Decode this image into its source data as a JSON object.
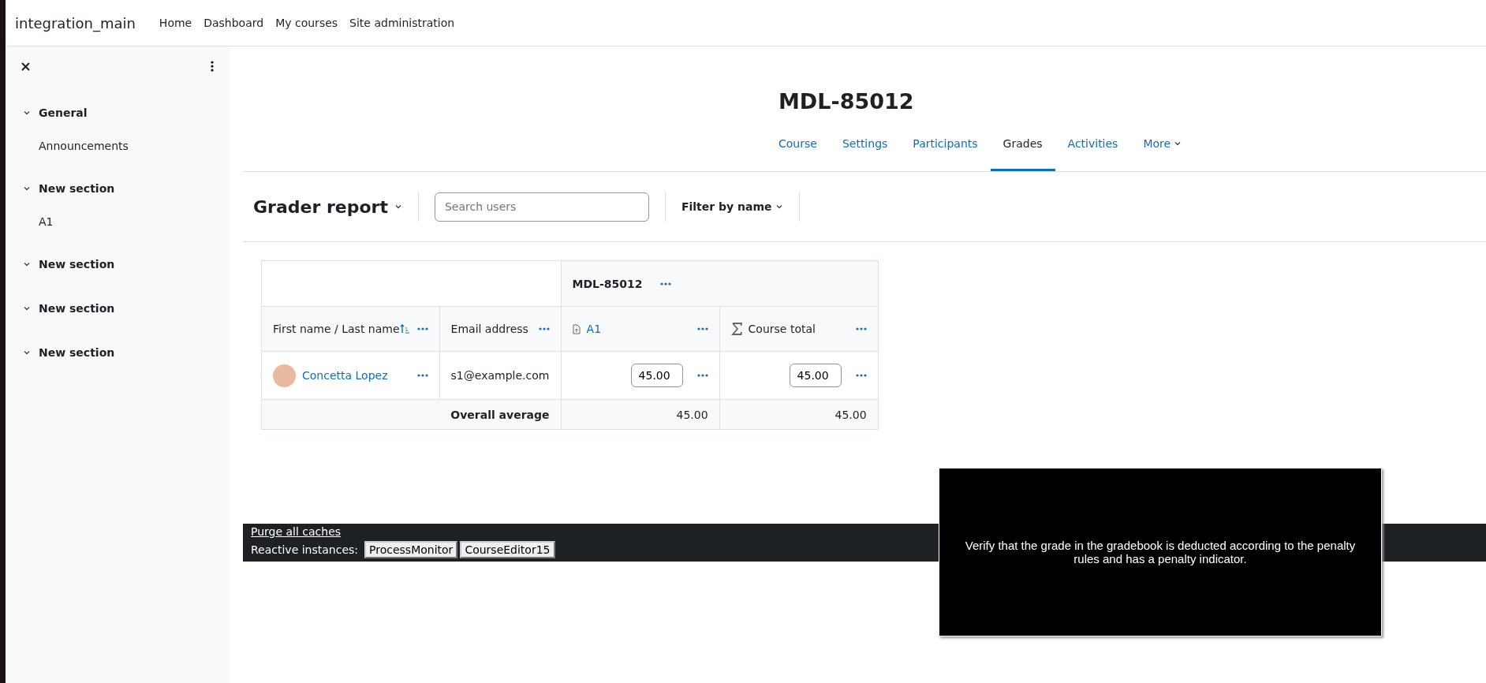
{
  "site_name": "integration_main",
  "nav": [
    "Home",
    "Dashboard",
    "My courses",
    "Site administration"
  ],
  "sidebar": {
    "sections": [
      {
        "title": "General",
        "expanded": true,
        "items": [
          "Announcements"
        ]
      },
      {
        "title": "New section",
        "expanded": true,
        "items": [
          "A1"
        ]
      },
      {
        "title": "New section",
        "expanded": true
      },
      {
        "title": "New section",
        "expanded": true
      },
      {
        "title": "New section",
        "expanded": true
      }
    ]
  },
  "course_title": "MDL-85012",
  "tabs": [
    {
      "label": "Course",
      "selected": false
    },
    {
      "label": "Settings",
      "selected": false
    },
    {
      "label": "Participants",
      "selected": false
    },
    {
      "label": "Grades",
      "selected": true
    },
    {
      "label": "Activities",
      "selected": false
    },
    {
      "label": "More",
      "selected": false,
      "dropdown": true
    }
  ],
  "report": {
    "title": "Grader report",
    "search": {
      "placeholder": "Search users"
    },
    "filter": "Filter by name"
  },
  "table": {
    "category": "MDL-85012",
    "columns": [
      {
        "label": "First name / Last name",
        "kind": "name"
      },
      {
        "label": "Email address",
        "kind": "text"
      },
      {
        "label": "A1",
        "kind": "assignment"
      },
      {
        "label": "Course total",
        "kind": "total"
      }
    ],
    "rows": [
      {
        "name": "Concetta Lopez",
        "email": "s1@example.com",
        "grades": [
          "45.00",
          "45.00"
        ]
      }
    ],
    "average": {
      "label": "Overall average",
      "values": [
        "45.00",
        "45.00"
      ]
    }
  },
  "footer": {
    "link": "Purge all caches",
    "label": "Reactive instances:",
    "buttons": [
      "ProcessMonitor",
      "CourseEditor15"
    ]
  },
  "overlay": {
    "text": "Verify that the grade in the gradebook is deducted according to the penalty rules and has a penalty indicator."
  }
}
